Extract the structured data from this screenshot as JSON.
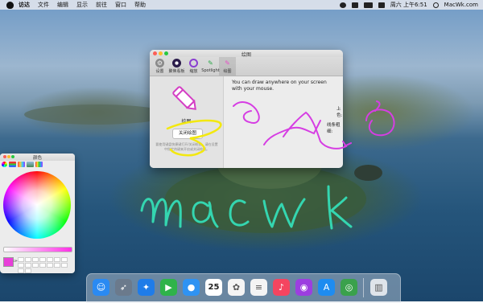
{
  "menubar": {
    "app_name": "访达",
    "items": [
      "文件",
      "编辑",
      "显示",
      "前往",
      "窗口",
      "帮助"
    ],
    "clock": "周六 上午6:51",
    "site": "MacWk.com"
  },
  "window": {
    "title": "绘图",
    "toolbar": [
      {
        "label": "设置",
        "icon": "gear-icon"
      },
      {
        "label": "聚焦看板",
        "icon": "spotlight-board-icon"
      },
      {
        "label": "缩放",
        "icon": "magnifier-icon"
      },
      {
        "label": "Spotlight",
        "icon": "spotlight-icon"
      },
      {
        "label": "绘图",
        "icon": "pencil-icon"
      }
    ],
    "left_title": "绘图",
    "close_button": "关闭绘图",
    "note": "要使用键盘快捷键打开/关闭绘图，请在设置中指定热键来开启或关闭绘图。",
    "info": "You can draw anywhere on your screen with your mouse.",
    "color_label": "上色:",
    "width_label": "线条粗细:",
    "pen_color": "#e83fd9",
    "line_width_fraction": 0.35
  },
  "colors_panel": {
    "title": "颜色",
    "current_color": "#e83fd9"
  },
  "scribbles": {
    "handwriting": "macwk",
    "pen_colors": [
      "#f3e80f",
      "#d63ee3",
      "#34d6b0"
    ]
  },
  "dock": {
    "apps": [
      {
        "name": "finder",
        "icon": "finder-icon",
        "color": "#2a8af2"
      },
      {
        "name": "launchpad",
        "icon": "rocket-icon",
        "color": "#6b7a8c"
      },
      {
        "name": "safari",
        "icon": "compass-icon",
        "color": "#1f7ce8"
      },
      {
        "name": "facetime",
        "icon": "video-icon",
        "color": "#2fb34a"
      },
      {
        "name": "messages",
        "icon": "chat-bubble-icon",
        "color": "#2f93f3"
      },
      {
        "name": "calendar",
        "icon": "calendar-icon",
        "color": "#ffffff",
        "text": "25"
      },
      {
        "name": "photos",
        "icon": "photos-icon",
        "color": "#f4f4f4"
      },
      {
        "name": "reminders",
        "icon": "list-icon",
        "color": "#f4f4f4"
      },
      {
        "name": "music",
        "icon": "music-note-icon",
        "color": "#f44560"
      },
      {
        "name": "podcasts",
        "icon": "podcast-icon",
        "color": "#9c3ee0"
      },
      {
        "name": "app-store",
        "icon": "app-store-icon",
        "color": "#1e8cf0"
      },
      {
        "name": "overflow-app",
        "icon": "circle-app-icon",
        "color": "#3aa14c"
      },
      {
        "name": "trash",
        "icon": "trash-icon",
        "color": "#dfe4ea"
      }
    ]
  }
}
